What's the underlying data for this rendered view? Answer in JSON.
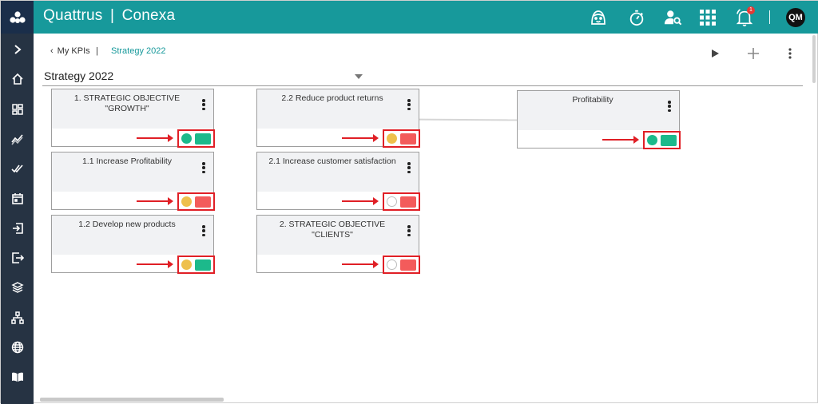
{
  "app": {
    "name": "Quattrus",
    "separator": "|",
    "product": "Conexa"
  },
  "colors": {
    "topbar": "#17999b",
    "sidebar": "#263343",
    "green": "#1cb98b",
    "yellow": "#eec04d",
    "red": "#f35b5b",
    "highlight": "#e01f26"
  },
  "topbar_icons": [
    "assistant-face-icon",
    "stopwatch-icon",
    "user-search-icon",
    "apps-grid-icon",
    "notifications-bell-icon"
  ],
  "notification_count": "1",
  "user": {
    "initials": "QM"
  },
  "sidebar": [
    "expand-chevron-icon",
    "home-icon",
    "dashboard-icon",
    "trend-icon",
    "double-check-icon",
    "calendar-icon",
    "login-icon",
    "logout-icon",
    "layers-icon",
    "hierarchy-icon",
    "globe-icon",
    "book-icon"
  ],
  "breadcrumb": {
    "back": "My KPIs",
    "sep": "|",
    "current": "Strategy 2022"
  },
  "page": {
    "title": "Strategy 2022"
  },
  "cards": [
    {
      "title": "1. STRATEGIC OBJECTIVE \"GROWTH\"",
      "dot": "green",
      "rect": "green"
    },
    {
      "title": "1.1 Increase Profitability",
      "dot": "yellow",
      "rect": "red"
    },
    {
      "title": "1.2 Develop new products",
      "dot": "yellow",
      "rect": "green"
    },
    {
      "title": "2.2 Reduce product returns",
      "dot": "yellow",
      "rect": "red"
    },
    {
      "title": "2.1 Increase customer satisfaction",
      "dot": "empty",
      "rect": "red"
    },
    {
      "title": "2. STRATEGIC OBJECTIVE \"CLIENTS\"",
      "dot": "empty",
      "rect": "red"
    },
    {
      "title": "Profitability",
      "dot": "green",
      "rect": "green"
    }
  ]
}
